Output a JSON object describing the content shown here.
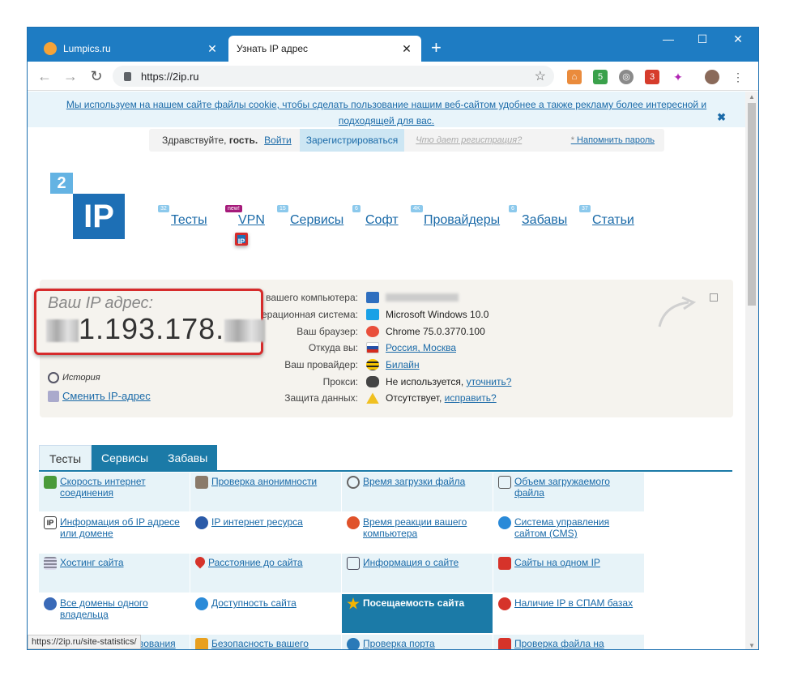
{
  "browser": {
    "tabs": [
      {
        "label": "Lumpics.ru",
        "active": false
      },
      {
        "label": "Узнать IP адрес",
        "active": true
      }
    ],
    "new_tab": "+",
    "url": "https://2ip.ru",
    "window_controls": {
      "minimize": "—",
      "maximize": "☐",
      "close": "✕"
    },
    "ext_badges": {
      "shield": "5",
      "mail": "3"
    },
    "status_url": "https://2ip.ru/site-statistics/"
  },
  "cookie": {
    "text": "Мы используем на нашем сайте файлы cookie, чтобы сделать пользование нашим веб-сайтом удобнее а также рекламу более интересной и подходящей для вас.",
    "close": "✖"
  },
  "login": {
    "greeting": "Здравствуйте,",
    "guest": "гость.",
    "login": "Войти",
    "register": "Зарегистрироваться",
    "why": "Что дает регистрация?",
    "asterisk": "*",
    "remind": "Напомнить пароль"
  },
  "logo": {
    "two": "2",
    "ip": "IP"
  },
  "nav": [
    {
      "label": "Тесты",
      "count": "32"
    },
    {
      "label": "VPN",
      "count": "new!"
    },
    {
      "label": "Сервисы",
      "count": "15"
    },
    {
      "label": "Софт",
      "count": "6"
    },
    {
      "label": "Провайдеры",
      "count": "4K"
    },
    {
      "label": "Забавы",
      "count": "6"
    },
    {
      "label": "Статьи",
      "count": "37"
    }
  ],
  "ip": {
    "caption": "Ваш IP адрес:",
    "visible_part": "1.193.178.",
    "history": "История",
    "change": "Сменить IP-адрес"
  },
  "info": [
    {
      "label": "Имя вашего компьютера:",
      "value": ""
    },
    {
      "label": "Операционная система:",
      "value": "Microsoft Windows 10.0"
    },
    {
      "label": "Ваш браузер:",
      "value": "Chrome 75.0.3770.100"
    },
    {
      "label": "Откуда вы:",
      "value": "Россия, Москва"
    },
    {
      "label": "Ваш провайдер:",
      "value": "Билайн"
    },
    {
      "label": "Прокси:",
      "value": "Не используется,",
      "link": "уточнить?"
    },
    {
      "label": "Защита данных:",
      "value": "Отсутствует,",
      "link": "исправить?"
    }
  ],
  "bottom_tabs": [
    "Тесты",
    "Сервисы",
    "Забавы"
  ],
  "services": [
    [
      "Скорость интернет соединения",
      "Проверка анонимности",
      "Время загрузки файла",
      "Объем загружаемого файла"
    ],
    [
      "Информация об IP адресе или домене",
      "IP интернет ресурса",
      "Время реакции вашего компьютера",
      "Система управления сайтом (CMS)"
    ],
    [
      "Хостинг сайта",
      "Расстояние до сайта",
      "Информация о сайте",
      "Сайты на одном IP"
    ],
    [
      "Все домены одного владельца",
      "Доступность сайта",
      "Посещаемость сайта",
      "Наличие IP в СПАМ базах"
    ],
    [
      "Проверка существования email",
      "Безопасность вашего компьютера",
      "Проверка порта",
      "Проверка файла на вирусы"
    ]
  ],
  "colors": {
    "accent": "#1b7aa7",
    "frame": "#1e7cc3",
    "alert": "#d62b2b"
  }
}
